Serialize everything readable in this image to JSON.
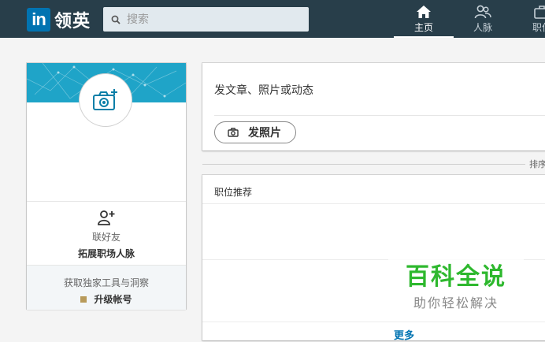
{
  "brand": {
    "logo_mark": "in",
    "name": "领英"
  },
  "search": {
    "placeholder": "搜索",
    "icon": "search-icon"
  },
  "nav": [
    {
      "label": "主页",
      "icon": "home-icon",
      "active": true
    },
    {
      "label": "人脉",
      "icon": "people-icon",
      "active": false
    },
    {
      "label": "职位",
      "icon": "briefcase-icon",
      "active": false
    }
  ],
  "profile": {
    "avatar_icon": "camera-plus-icon",
    "connect_label": "联好友",
    "connect_cta": "拓展职场人脉",
    "upgrade_label": "获取独家工具与洞察",
    "upgrade_cta": "升级帐号"
  },
  "share": {
    "prompt": "发文章、照片或动态",
    "photo_button": "发照片"
  },
  "feed": {
    "sort_label": "排序"
  },
  "jobs": {
    "title": "职位推荐",
    "more_link": "更多"
  },
  "watermark": {
    "title": "百科全说",
    "subtitle": "助你轻松解决"
  },
  "colors": {
    "topbar": "#283e4a",
    "brand_blue": "#0073b1",
    "banner": "#1fa4c8",
    "watermark_green": "#2eb82e"
  }
}
